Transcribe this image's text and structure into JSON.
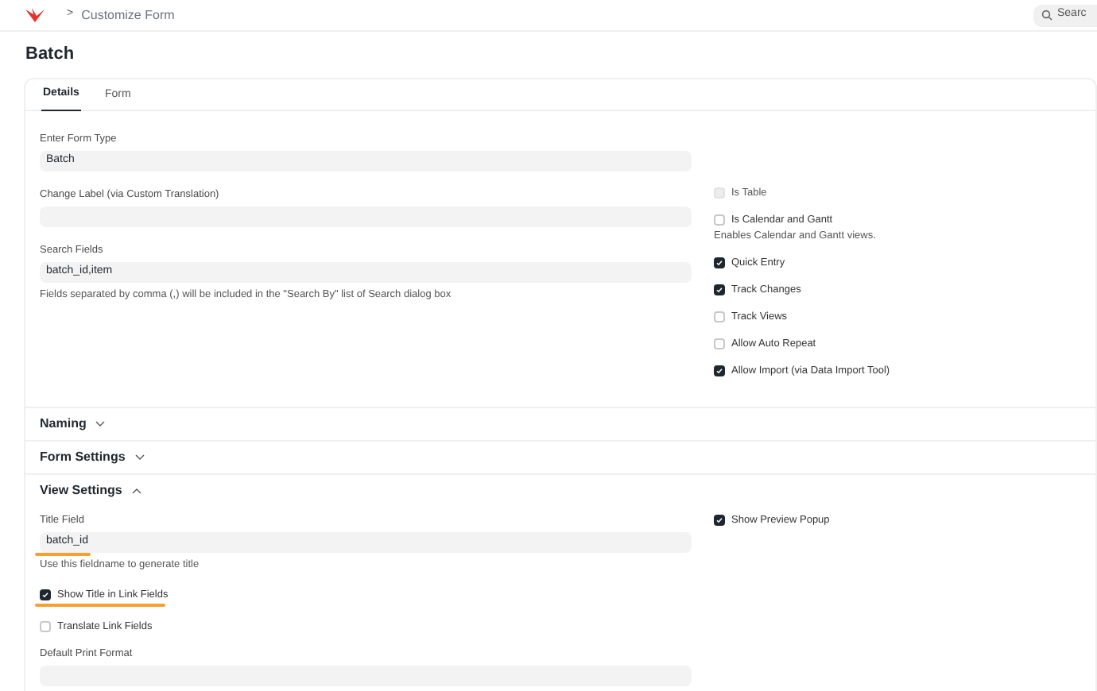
{
  "breadcrumb": {
    "separator": ">",
    "label": "Customize Form"
  },
  "search": {
    "placeholder": "Searc"
  },
  "page_title": "Batch",
  "tabs": [
    {
      "label": "Details",
      "selected": true
    },
    {
      "label": "Form",
      "selected": false
    }
  ],
  "main_section": {
    "left": [
      {
        "kind": "field",
        "label": "Enter Form Type",
        "value": "Batch"
      },
      {
        "kind": "field",
        "label": "Change Label (via Custom Translation)"
      },
      {
        "kind": "field",
        "label": "Search Fields",
        "value": "batch_id,item",
        "description": "Fields separated by comma (,) will be included in the \"Search By\" list of Search dialog box"
      }
    ],
    "right": [
      {
        "kind": "checkbox",
        "label": "Is Table",
        "checked": false,
        "disabled": true
      },
      {
        "kind": "checkbox",
        "label": "Is Calendar and Gantt",
        "checked": false,
        "description": "Enables Calendar and Gantt views."
      },
      {
        "kind": "checkbox",
        "label": "Quick Entry",
        "checked": true
      },
      {
        "kind": "checkbox",
        "label": "Track Changes",
        "checked": true
      },
      {
        "kind": "checkbox",
        "label": "Track Views",
        "checked": false
      },
      {
        "kind": "checkbox",
        "label": "Allow Auto Repeat",
        "checked": false
      },
      {
        "kind": "checkbox",
        "label": "Allow Import (via Data Import Tool)",
        "checked": true
      }
    ]
  },
  "sections": [
    {
      "title": "Naming",
      "expanded": false
    },
    {
      "title": "Form Settings",
      "expanded": false
    },
    {
      "title": "View Settings",
      "expanded": true,
      "left": [
        {
          "kind": "field",
          "label": "Title Field",
          "value": "batch_id",
          "description": "Use this fieldname to generate title",
          "underlined": true
        },
        {
          "kind": "checkbox",
          "label": "Show Title in Link Fields",
          "checked": true,
          "underlined": true
        },
        {
          "kind": "checkbox",
          "label": "Translate Link Fields",
          "checked": false
        },
        {
          "kind": "field",
          "label": "Default Print Format"
        }
      ],
      "right": [
        {
          "kind": "checkbox",
          "label": "Show Preview Popup",
          "checked": true
        }
      ]
    }
  ]
}
